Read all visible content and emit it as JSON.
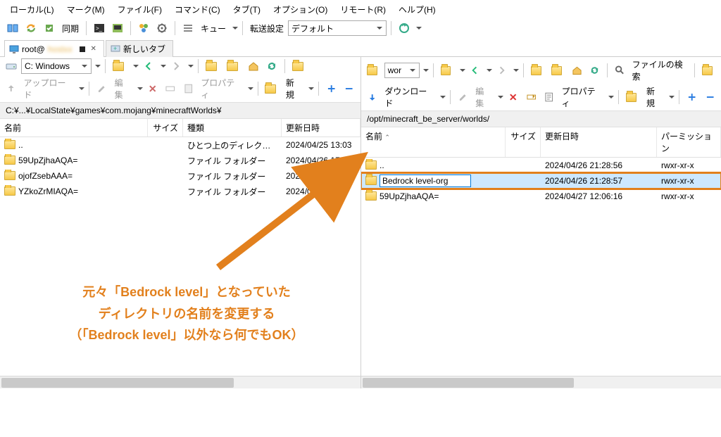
{
  "menu": {
    "local": "ローカル(L)",
    "mark": "マーク(M)",
    "file": "ファイル(F)",
    "command": "コマンド(C)",
    "tab": "タブ(T)",
    "options": "オプション(O)",
    "remote": "リモート(R)",
    "help": "ヘルプ(H)"
  },
  "toolbar1": {
    "sync": "同期",
    "queue": "キュー",
    "transfer_label": "転送設定",
    "transfer_value": "デフォルト"
  },
  "tabs": {
    "active": "root@",
    "new": "新しいタブ"
  },
  "left": {
    "drive": "C: Windows",
    "upload": "アップロード",
    "edit": "編集",
    "properties": "プロパティ",
    "new": "新規",
    "path": "C:¥...¥LocalState¥games¥com.mojang¥minecraftWorlds¥",
    "cols": {
      "name": "名前",
      "size": "サイズ",
      "type": "種類",
      "date": "更新日時"
    },
    "rows": [
      {
        "name": "..",
        "type": "ひとつ上のディレクトリ",
        "date": "2024/04/25 13:03"
      },
      {
        "name": "59UpZjhaAQA=",
        "type": "ファイル フォルダー",
        "date": "2024/04/26 17:04"
      },
      {
        "name": "ojofZsebAAA=",
        "type": "ファイル フォルダー",
        "date": "2024/04/17 13:4"
      },
      {
        "name": "YZkoZrMIAQA=",
        "type": "ファイル フォルダー",
        "date": "2024/04/2"
      }
    ]
  },
  "right": {
    "drive": "wor",
    "download": "ダウンロード",
    "edit": "編集",
    "properties": "プロパティ",
    "new": "新規",
    "find": "ファイルの検索",
    "path": "/opt/minecraft_be_server/worlds/",
    "cols": {
      "name": "名前",
      "size": "サイズ",
      "date": "更新日時",
      "perm": "パーミッション"
    },
    "rename_value": "Bedrock level-org",
    "rows": [
      {
        "name": "..",
        "date": "2024/04/26 21:28:56",
        "perm": "rwxr-xr-x"
      },
      {
        "name": "Bedrock level-org",
        "date": "2024/04/26 21:28:57",
        "perm": "rwxr-xr-x",
        "editing": true
      },
      {
        "name": "59UpZjhaAQA=",
        "date": "2024/04/27 12:06:16",
        "perm": "rwxr-xr-x"
      }
    ]
  },
  "annotation": {
    "l1": "元々「Bedrock level」となっていた",
    "l2": "ディレクトリの名前を変更する",
    "l3": "（「Bedrock level」以外なら何でもOK）"
  }
}
